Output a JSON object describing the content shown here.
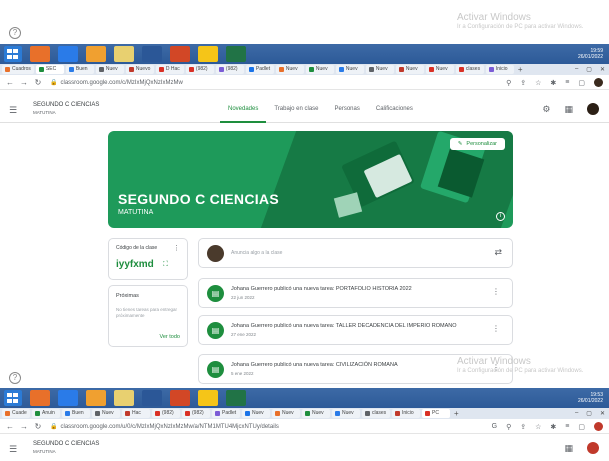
{
  "watermark": {
    "title": "Activar Windows",
    "subtitle": "Ir a Configuración de PC para activar Windows."
  },
  "taskbar": {
    "time": "19:59",
    "date": "26/01/2022",
    "time2": "19:53",
    "date2": "26/01/2022"
  },
  "tabs_top": [
    "Cuadros",
    "SEC",
    "Buen",
    "Nuev",
    "Nuevo",
    "D Hac",
    "(982)",
    "(982)",
    "Padlet",
    "Nuev",
    "Nuev",
    "Nuev",
    "Nuev",
    "Nuev",
    "Nuev",
    "clases",
    "Inicio"
  ],
  "tabs_bottom": [
    "Cuade",
    "Anuin",
    "Buen",
    "Nuev",
    "Hac",
    "(982)",
    "(982)",
    "Padlet",
    "Nuev",
    "Nuev",
    "Nuev",
    "Nuev",
    "clases",
    "Inicio",
    "PC"
  ],
  "url_top": "classroom.google.com/c/MzIxMjQxNzIxMzMw",
  "url_bottom": "classroom.google.com/u/0/c/MzIxMjQxNzIxMzMw/a/NTM1MTU4MjcxNTUy/details",
  "course": {
    "name": "SEGUNDO C CIENCIAS",
    "section": "MATUTINA"
  },
  "nav_tabs": [
    "Novedades",
    "Trabajo en clase",
    "Personas",
    "Calificaciones"
  ],
  "banner": {
    "title": "SEGUNDO C CIENCIAS",
    "subtitle": "MATUTINA",
    "customize": "Personalizar"
  },
  "class_code": {
    "label": "Código de la clase",
    "value": "iyyfxmd"
  },
  "upcoming": {
    "title": "Próximas",
    "body": "No tienes tareas para entregar próximamente",
    "link": "Ver todo"
  },
  "announce": {
    "placeholder": "Anuncia algo a la clase"
  },
  "posts": [
    {
      "title": "Johana Guerrero publicó una nueva tarea: PORTAFOLIO HISTORIA 2022",
      "date": "22 jun 2022"
    },
    {
      "title": "Johana Guerrero publicó una nueva tarea: TALLER DECADENCIA DEL IMPERIO ROMANO",
      "date": "27 ene 2022"
    },
    {
      "title": "Johana Guerrero publicó una nueva tarea: CIVILIZACIÓN ROMANA",
      "date": "5 ene 2022"
    }
  ],
  "colors": {
    "accent": "#1e8e3e",
    "banner": "#1e9a5a",
    "taskbar": "#3d6aa6"
  }
}
